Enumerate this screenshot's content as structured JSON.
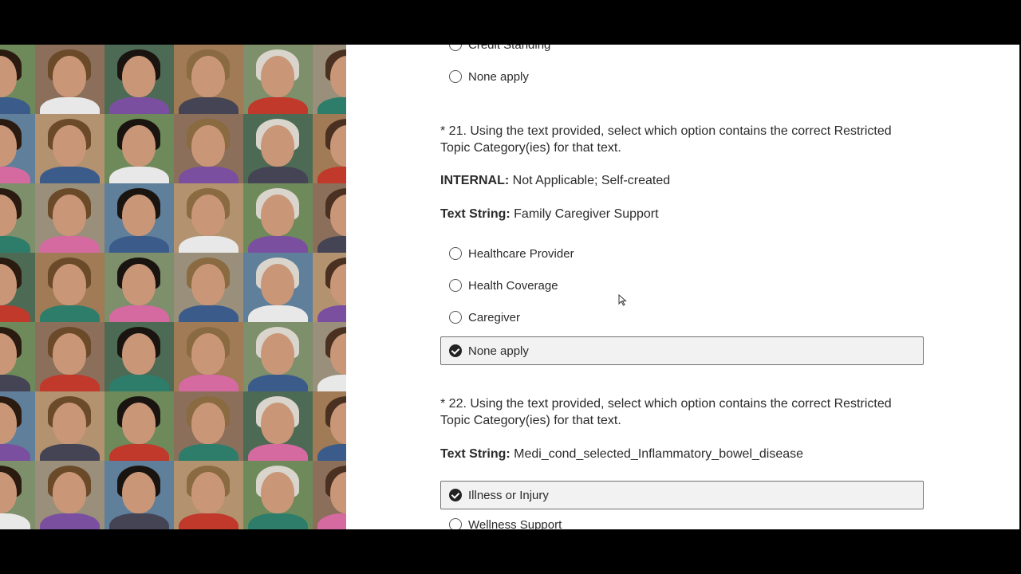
{
  "photo_grid": {
    "icon": "photo-grid-faces",
    "rows": 7,
    "cols": 5,
    "palette": [
      "#c99778",
      "#8a5a3b",
      "#e2b695",
      "#5c3a24",
      "#d8a27d",
      "#b07a55",
      "#f0c9a8"
    ],
    "backgrounds": [
      "#6f8a5a",
      "#a07b55",
      "#5f7f9a",
      "#8c6f5a",
      "#7d8f6b",
      "#b39270",
      "#4d6a55",
      "#9a8f7a"
    ]
  },
  "prev_options": [
    {
      "label": "Credit Standing",
      "selected": false
    },
    {
      "label": "None apply",
      "selected": false
    }
  ],
  "q21": {
    "question": "* 21. Using the text provided, select which option contains the correct Restricted Topic Category(ies) for that text.",
    "internal_label": "INTERNAL:",
    "internal_value": "Not Applicable; Self-created",
    "text_label": "Text String:",
    "text_value": "Family Caregiver Support",
    "options": [
      {
        "label": "Healthcare Provider",
        "selected": false
      },
      {
        "label": "Health Coverage",
        "selected": false
      },
      {
        "label": "Caregiver",
        "selected": false
      },
      {
        "label": "None apply",
        "selected": true
      }
    ]
  },
  "q22": {
    "question": "* 22. Using the text provided, select which option contains the correct Restricted Topic Category(ies) for that text.",
    "text_label": "Text String:",
    "text_value": "Medi_cond_selected_Inflammatory_bowel_disease",
    "options": [
      {
        "label": "Illness or Injury",
        "selected": true
      },
      {
        "label": "Wellness Support",
        "selected": false
      }
    ]
  }
}
